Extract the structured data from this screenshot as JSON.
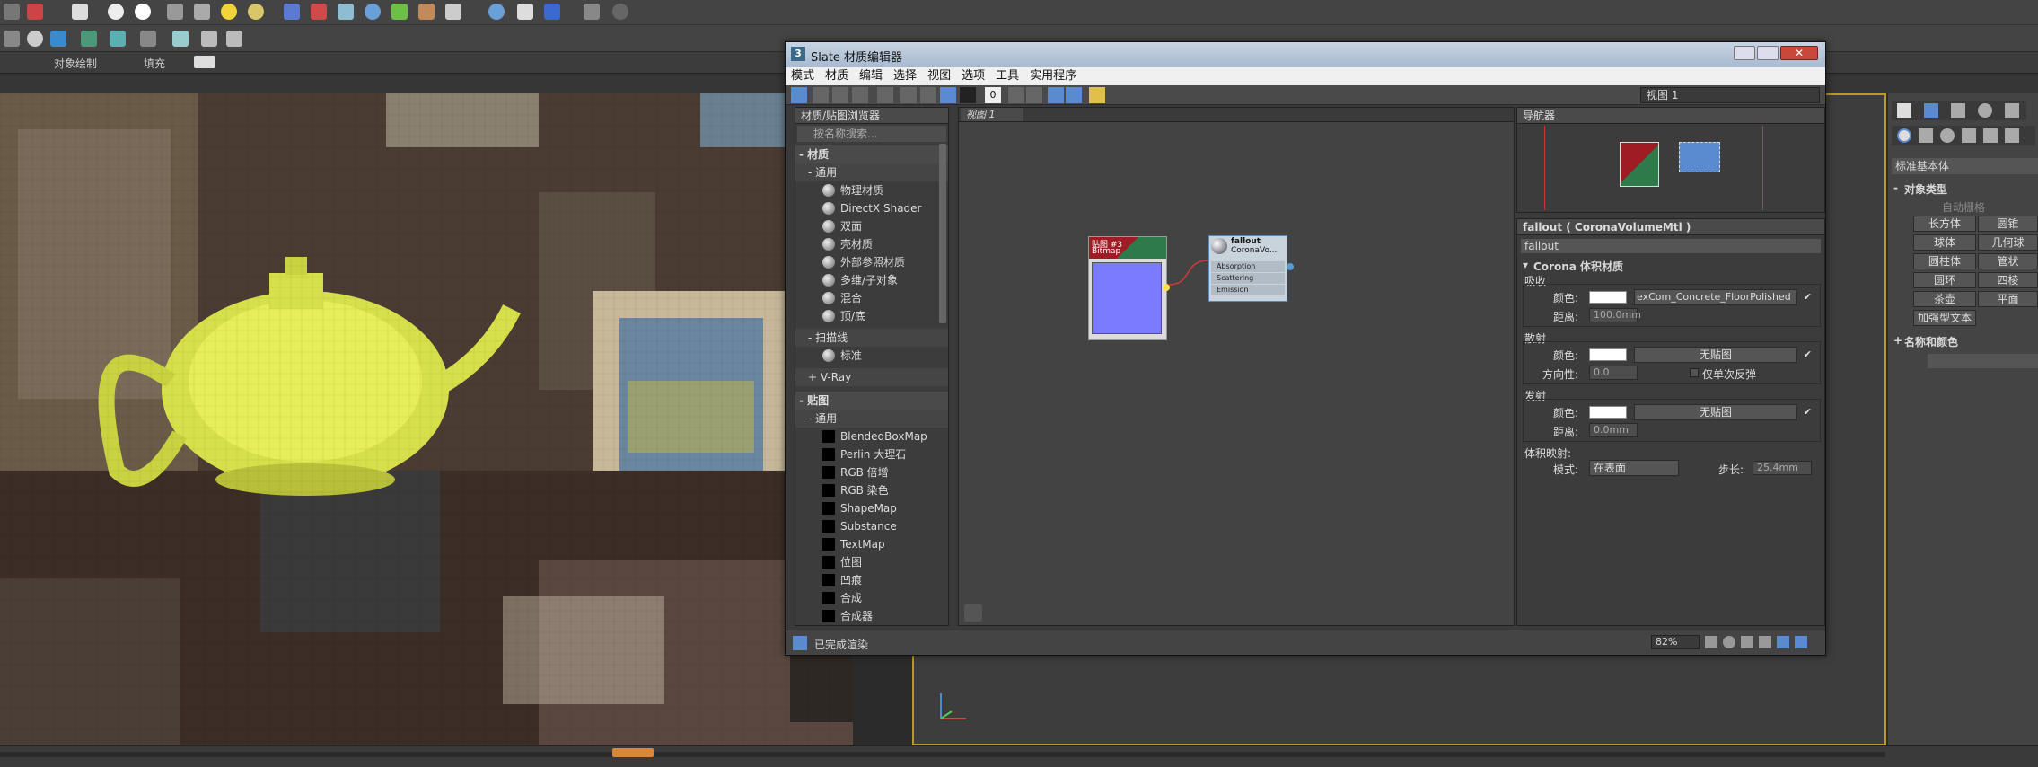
{
  "topbar": {
    "object_paint_label": "对象绘制",
    "fill_label": "填充"
  },
  "slate": {
    "title": "Slate 材质编辑器",
    "window_icon_label": "3",
    "menu": [
      "模式",
      "材质",
      "编辑",
      "选择",
      "视图",
      "选项",
      "工具",
      "实用程序"
    ],
    "view_dropdown": "视图 1",
    "browser": {
      "title": "材质/贴图浏览器",
      "search_placeholder": "按名称搜索...",
      "sections": {
        "materials": "- 材质",
        "general": "- 通用",
        "scanline": "- 扫描线",
        "vray": "+ V-Ray",
        "maps": "- 贴图",
        "maps_general": "- 通用"
      },
      "material_items": [
        "物理材质",
        "DirectX Shader",
        "双面",
        "壳材质",
        "外部参照材质",
        "多维/子对象",
        "混合",
        "顶/底"
      ],
      "scanline_items": [
        "标准"
      ],
      "map_items": [
        "BlendedBoxMap",
        "Perlin 大理石",
        "RGB 倍增",
        "RGB 染色",
        "ShapeMap",
        "Substance",
        "TextMap",
        "位图",
        "凹痕",
        "合成",
        "合成器"
      ]
    },
    "view_tab": "视图 1",
    "nodes": {
      "bitmap_title": "贴图 #3",
      "bitmap_sub": "Bitmap",
      "fallout_title": "fallout",
      "fallout_sub": "CoronaVo...",
      "slots": [
        "Absorption",
        "Scattering",
        "Emission"
      ]
    },
    "navigator_title": "导航器",
    "props": {
      "title": "fallout  ( CoronaVolumeMtl )",
      "name_field": "fallout",
      "rollout": "Corona 体积材质",
      "absorption": "吸收",
      "color_label": "颜色:",
      "absorption_map": "exCom_Concrete_FloorPolished",
      "distance_label": "距离:",
      "absorption_distance": "100.0mm",
      "scattering": "散射",
      "no_map": "无贴图",
      "directionality_label": "方向性:",
      "directionality_value": "0.0",
      "single_bounce": "仅单次反弹",
      "emission": "发射",
      "emission_distance": "0.0mm",
      "volume_mapping": "体积映射:",
      "mode_label": "模式:",
      "mode_value": "在表面",
      "step_label": "步长:",
      "step_value": "25.4mm"
    },
    "status": "已完成渲染",
    "zoom": "82%"
  },
  "rightpanel": {
    "dropdown": "标准基本体",
    "object_type": "对象类型",
    "autogrid": "自动栅格",
    "buttons": [
      "长方体",
      "圆锥",
      "球体",
      "几何球",
      "圆柱体",
      "管状",
      "圆环",
      "四棱",
      "茶壶",
      "平面",
      "加强型文本"
    ],
    "name_color": "名称和颜色"
  },
  "colors": {
    "accent": "#b89a2a",
    "bitmap_header": "#a01c24",
    "bitmap_header2": "#2e7a4a",
    "bitmap_preview": "#7b7bff",
    "wire": "#d23a3a"
  }
}
